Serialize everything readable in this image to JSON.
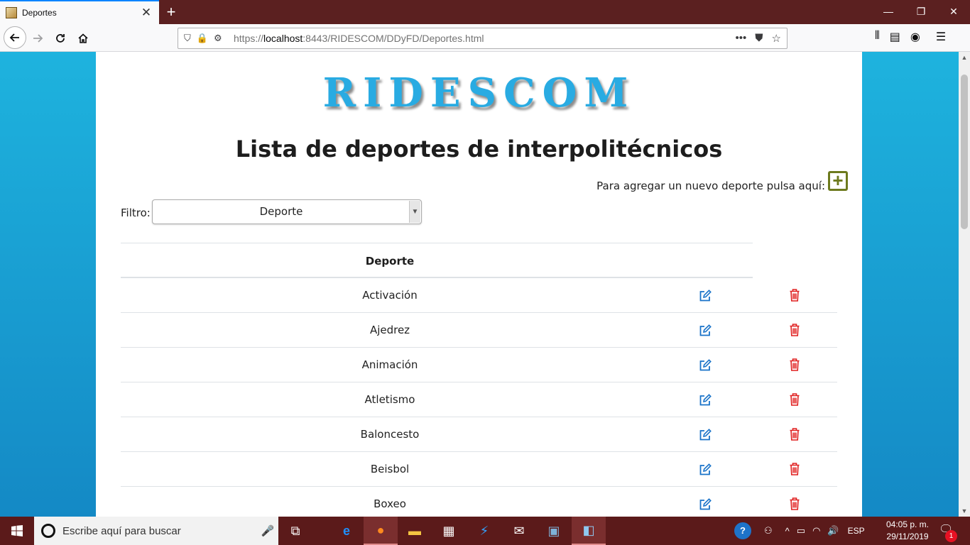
{
  "browser": {
    "tab_title": "Deportes",
    "url_prefix": "https://",
    "url_host": "localhost",
    "url_rest": ":8443/RIDESCOM/DDyFD/Deportes.html",
    "new_tab_icon": "plus-icon"
  },
  "page": {
    "logo": "RIDESCOM",
    "title": "Lista de deportes de interpolitécnicos",
    "add_text": "Para agregar un nuevo deporte pulsa aquí:",
    "filter_label": "Filtro:",
    "filter_value": "Deporte",
    "table_header": "Deporte",
    "edit_color": "#1a73c9",
    "delete_color": "#e02020",
    "add_color": "#6d7a1e",
    "rows": [
      "Activación",
      "Ajedrez",
      "Animación",
      "Atletismo",
      "Baloncesto",
      "Beisbol",
      "Boxeo"
    ]
  },
  "taskbar": {
    "search_placeholder": "Escribe aquí para buscar",
    "language": "ESP",
    "time": "04:05 p. m.",
    "date": "29/11/2019",
    "notifications": "1"
  }
}
